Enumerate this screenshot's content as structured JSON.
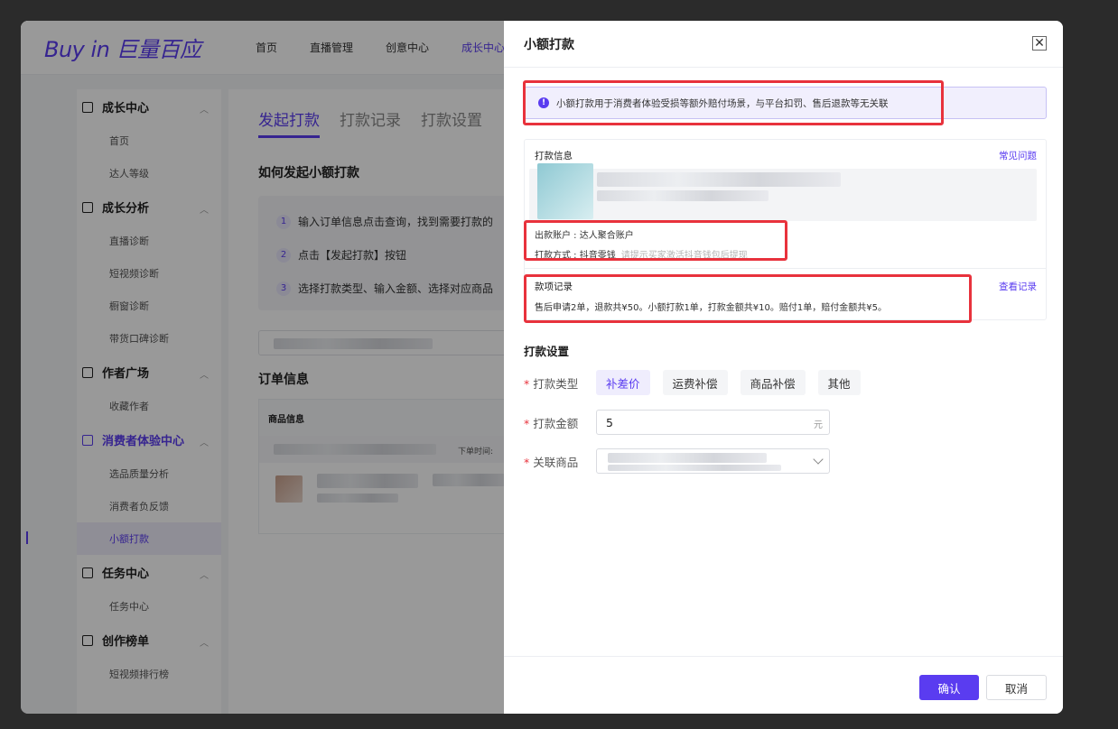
{
  "app": {
    "logo": "Buy in 巨量百应",
    "nav": [
      {
        "label": "首页",
        "active": false
      },
      {
        "label": "直播管理",
        "active": false
      },
      {
        "label": "创意中心",
        "active": false
      },
      {
        "label": "成长中心",
        "active": true
      }
    ]
  },
  "sidebar": {
    "groups": [
      {
        "label": "成长中心",
        "items": [
          "首页",
          "达人等级"
        ]
      },
      {
        "label": "成长分析",
        "items": [
          "直播诊断",
          "短视频诊断",
          "橱窗诊断",
          "带货口碑诊断"
        ]
      },
      {
        "label": "作者广场",
        "items": [
          "收藏作者"
        ]
      },
      {
        "label": "消费者体验中心",
        "items": [
          "选品质量分析",
          "消费者负反馈",
          "小额打款"
        ]
      },
      {
        "label": "任务中心",
        "items": [
          "任务中心"
        ]
      },
      {
        "label": "创作榜单",
        "items": [
          "短视频排行榜"
        ]
      }
    ]
  },
  "content": {
    "tabs": [
      "发起打款",
      "打款记录",
      "打款设置"
    ],
    "howto_title": "如何发起小额打款",
    "steps": [
      {
        "num": "1",
        "text": "输入订单信息点击查询，找到需要打款的"
      },
      {
        "num": "2",
        "text": "点击【发起打款】按钮"
      },
      {
        "num": "3",
        "text": "选择打款类型、输入金额、选择对应商品"
      }
    ],
    "order_title": "订单信息",
    "order_head": "商品信息",
    "order_time_label": "下单时间:"
  },
  "drawer": {
    "title": "小额打款",
    "close": "✕",
    "notice": "小额打款用于消费者体验受损等额外赔付场景，与平台扣罚、售后退款等无关联",
    "notice_icon": "!",
    "pay_info_title": "打款信息",
    "faq_link": "常见问题",
    "account_line": "出款账户 :  达人聚合账户",
    "method_label": "打款方式 :  抖音零钱",
    "method_hint": "请提示买家激活抖音钱包后提现",
    "record_title": "款项记录",
    "record_link": "查看记录",
    "record_text": "售后申请2单，退款共¥50。小额打款1单，打款金额共¥10。赔付1单，赔付金额共¥5。",
    "settings_title": "打款设置",
    "type_label": "打款类型",
    "type_options": [
      "补差价",
      "运费补偿",
      "商品补偿",
      "其他"
    ],
    "amount_label": "打款金额",
    "amount_value": "5",
    "amount_unit": "元",
    "product_label": "关联商品",
    "confirm": "确认",
    "cancel": "取消"
  },
  "colors": {
    "brand": "#5a3cf0",
    "highlight": "#e8323c"
  }
}
